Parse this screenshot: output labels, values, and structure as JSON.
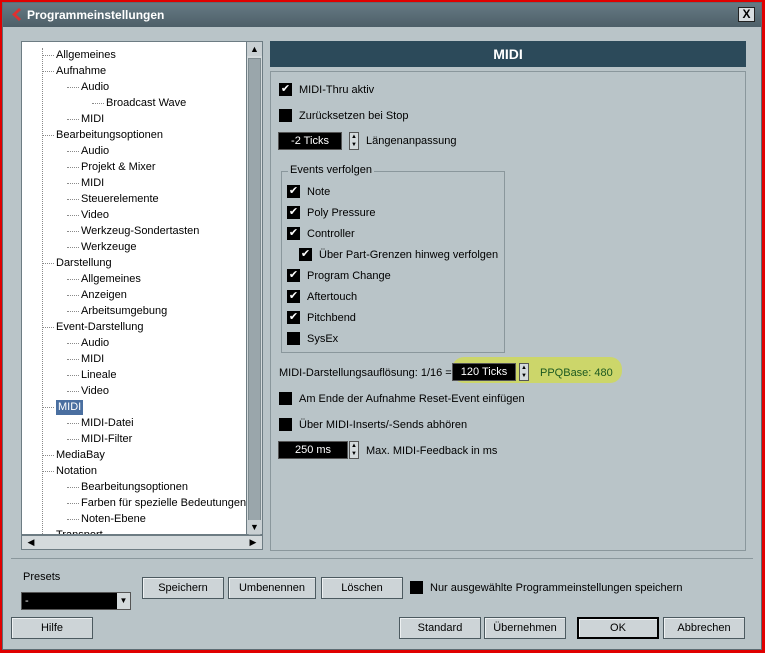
{
  "window": {
    "title": "Programmeinstellungen",
    "close_label": "X"
  },
  "tree": {
    "items": [
      {
        "label": "Allgemeines",
        "level": 0
      },
      {
        "label": "Aufnahme",
        "level": 0
      },
      {
        "label": "Audio",
        "level": 1
      },
      {
        "label": "Broadcast Wave",
        "level": 2
      },
      {
        "label": "MIDI",
        "level": 1
      },
      {
        "label": "Bearbeitungsoptionen",
        "level": 0
      },
      {
        "label": "Audio",
        "level": 1
      },
      {
        "label": "Projekt & Mixer",
        "level": 1
      },
      {
        "label": "MIDI",
        "level": 1
      },
      {
        "label": "Steuerelemente",
        "level": 1
      },
      {
        "label": "Video",
        "level": 1
      },
      {
        "label": "Werkzeug-Sondertasten",
        "level": 1
      },
      {
        "label": "Werkzeuge",
        "level": 1
      },
      {
        "label": "Darstellung",
        "level": 0
      },
      {
        "label": "Allgemeines",
        "level": 1
      },
      {
        "label": "Anzeigen",
        "level": 1
      },
      {
        "label": "Arbeitsumgebung",
        "level": 1
      },
      {
        "label": "Event-Darstellung",
        "level": 0
      },
      {
        "label": "Audio",
        "level": 1
      },
      {
        "label": "MIDI",
        "level": 1
      },
      {
        "label": "Lineale",
        "level": 1
      },
      {
        "label": "Video",
        "level": 1
      },
      {
        "label": "MIDI",
        "level": 0,
        "selected": true
      },
      {
        "label": "MIDI-Datei",
        "level": 1
      },
      {
        "label": "MIDI-Filter",
        "level": 1
      },
      {
        "label": "MediaBay",
        "level": 0
      },
      {
        "label": "Notation",
        "level": 0
      },
      {
        "label": "Bearbeitungsoptionen",
        "level": 1
      },
      {
        "label": "Farben für spezielle Bedeutungen",
        "level": 1
      },
      {
        "label": "Noten-Ebene",
        "level": 1
      },
      {
        "label": "Transport",
        "level": 0
      }
    ]
  },
  "panel": {
    "title": "MIDI",
    "midi_thru": "MIDI-Thru aktiv",
    "reset_on_stop": "Zurücksetzen bei Stop",
    "length_value": "-2 Ticks",
    "length_label": "Längenanpassung",
    "events_group": "Events verfolgen",
    "events": [
      "Note",
      "Poly Pressure",
      "Controller",
      "Über Part-Grenzen hinweg verfolgen",
      "Program Change",
      "Aftertouch",
      "Pitchbend",
      "SysEx"
    ],
    "resolution_label": "MIDI-Darstellungsauflösung: 1/16 =",
    "resolution_value": "120 Ticks",
    "ppq": "PPQBase: 480",
    "reset_event": "Am Ende der Aufnahme Reset-Event einfügen",
    "inserts_sends": "Über MIDI-Inserts/-Sends abhören",
    "feedback_value": "250 ms",
    "feedback_label": "Max. MIDI-Feedback in ms"
  },
  "presets": {
    "label": "Presets",
    "value": "-",
    "save": "Speichern",
    "rename": "Umbenennen",
    "delete": "Löschen",
    "only_selected": "Nur ausgewählte Programmeinstellungen speichern"
  },
  "footer": {
    "help": "Hilfe",
    "standard": "Standard",
    "apply": "Übernehmen",
    "ok": "OK",
    "cancel": "Abbrechen"
  }
}
